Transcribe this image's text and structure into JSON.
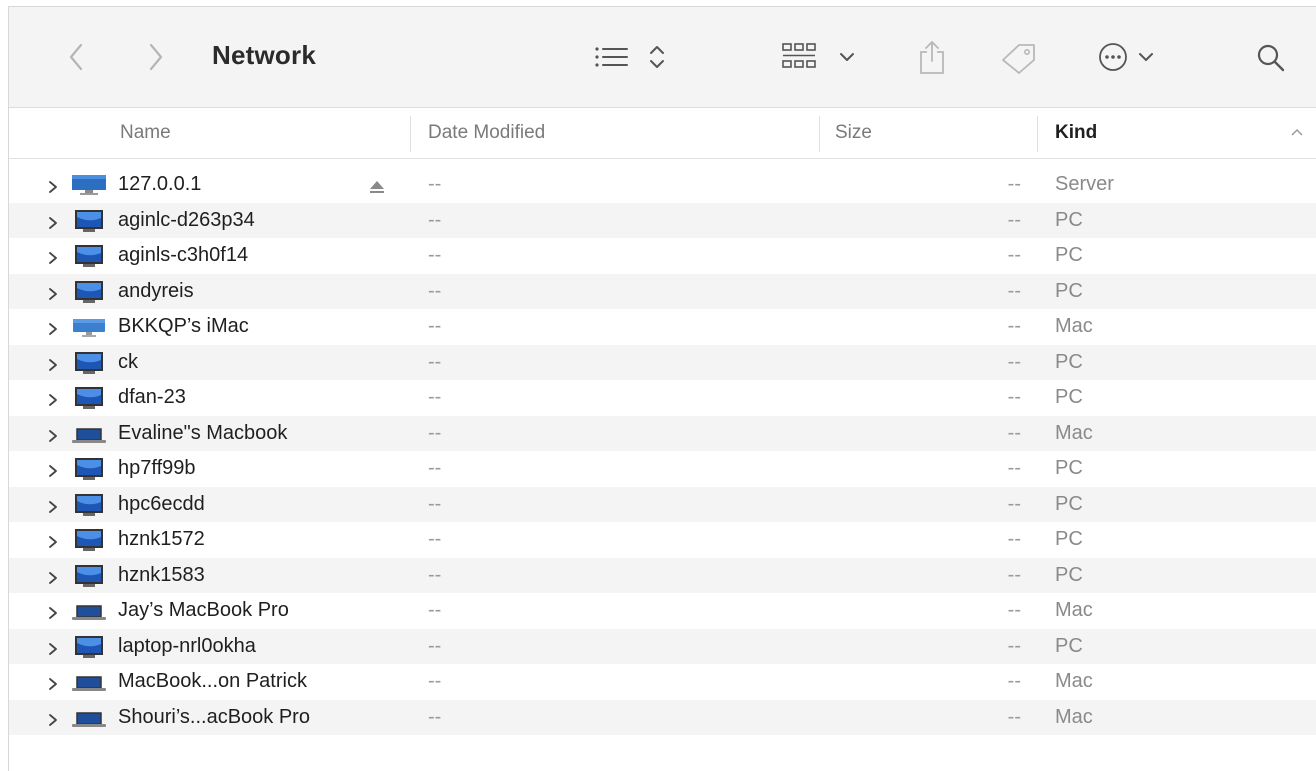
{
  "window": {
    "title": "Network",
    "toolbar": {
      "back_icon": "chevron-left-icon",
      "forward_icon": "chevron-right-icon",
      "view_icon": "list-view-icon",
      "group_icon": "grid-group-icon",
      "share_icon": "share-icon",
      "tag_icon": "tag-icon",
      "action_icon": "ellipsis-circle-icon",
      "search_icon": "search-icon"
    }
  },
  "columns": {
    "name": "Name",
    "date": "Date Modified",
    "size": "Size",
    "kind": "Kind",
    "sort_column": "Kind",
    "sort_direction": "ascending"
  },
  "rows": [
    {
      "name": "127.0.0.1",
      "date": "--",
      "size": "--",
      "kind": "Server",
      "icon": "server-icon",
      "eject": true
    },
    {
      "name": "aginlc-d263p34",
      "date": "--",
      "size": "--",
      "kind": "PC",
      "icon": "pc-monitor-icon"
    },
    {
      "name": "aginls-c3h0f14",
      "date": "--",
      "size": "--",
      "kind": "PC",
      "icon": "pc-monitor-icon"
    },
    {
      "name": "andyreis",
      "date": "--",
      "size": "--",
      "kind": "PC",
      "icon": "pc-monitor-icon"
    },
    {
      "name": "BKKQP’s iMac",
      "date": "--",
      "size": "--",
      "kind": "Mac",
      "icon": "imac-icon"
    },
    {
      "name": "ck",
      "date": "--",
      "size": "--",
      "kind": "PC",
      "icon": "pc-monitor-icon"
    },
    {
      "name": "dfan-23",
      "date": "--",
      "size": "--",
      "kind": "PC",
      "icon": "pc-monitor-icon"
    },
    {
      "name": "Evaline\"s Macbook",
      "date": "--",
      "size": "--",
      "kind": "Mac",
      "icon": "macbook-icon"
    },
    {
      "name": "hp7ff99b",
      "date": "--",
      "size": "--",
      "kind": "PC",
      "icon": "pc-monitor-icon"
    },
    {
      "name": "hpc6ecdd",
      "date": "--",
      "size": "--",
      "kind": "PC",
      "icon": "pc-monitor-icon"
    },
    {
      "name": "hznk1572",
      "date": "--",
      "size": "--",
      "kind": "PC",
      "icon": "pc-monitor-icon"
    },
    {
      "name": "hznk1583",
      "date": "--",
      "size": "--",
      "kind": "PC",
      "icon": "pc-monitor-icon"
    },
    {
      "name": "Jay’s MacBook Pro",
      "date": "--",
      "size": "--",
      "kind": "Mac",
      "icon": "macbook-icon"
    },
    {
      "name": "laptop-nrl0okha",
      "date": "--",
      "size": "--",
      "kind": "PC",
      "icon": "pc-monitor-icon"
    },
    {
      "name": "MacBook...on Patrick",
      "date": "--",
      "size": "--",
      "kind": "Mac",
      "icon": "macbook-icon"
    },
    {
      "name": "Shouri’s...acBook Pro",
      "date": "--",
      "size": "--",
      "kind": "Mac",
      "icon": "macbook-icon"
    }
  ]
}
